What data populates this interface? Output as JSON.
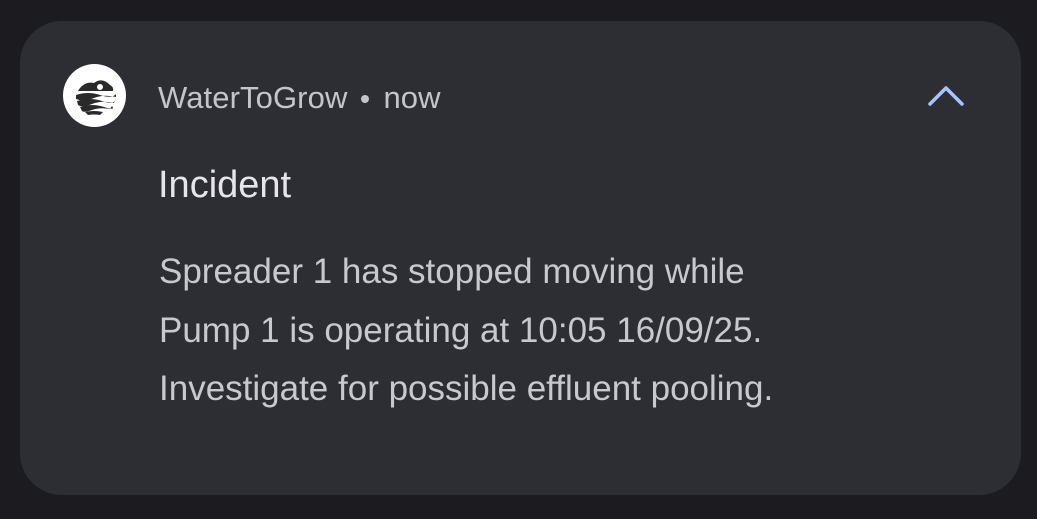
{
  "notification": {
    "app_name": "WaterToGrow",
    "time": "now",
    "app_icon": "watertogrow-logo-icon",
    "expand_icon": "chevron-up-icon",
    "title": "Incident",
    "body_lines": [
      "Spreader 1 has stopped moving while",
      "Pump 1 is operating at 10:05 16/09/25.",
      "Investigate for possible effluent pooling."
    ]
  },
  "colors": {
    "background": "#1c1c20",
    "card": "#2d2e33",
    "title": "#e6e6ea",
    "body": "#c8c9ce",
    "accent": "#a8c4ff"
  }
}
